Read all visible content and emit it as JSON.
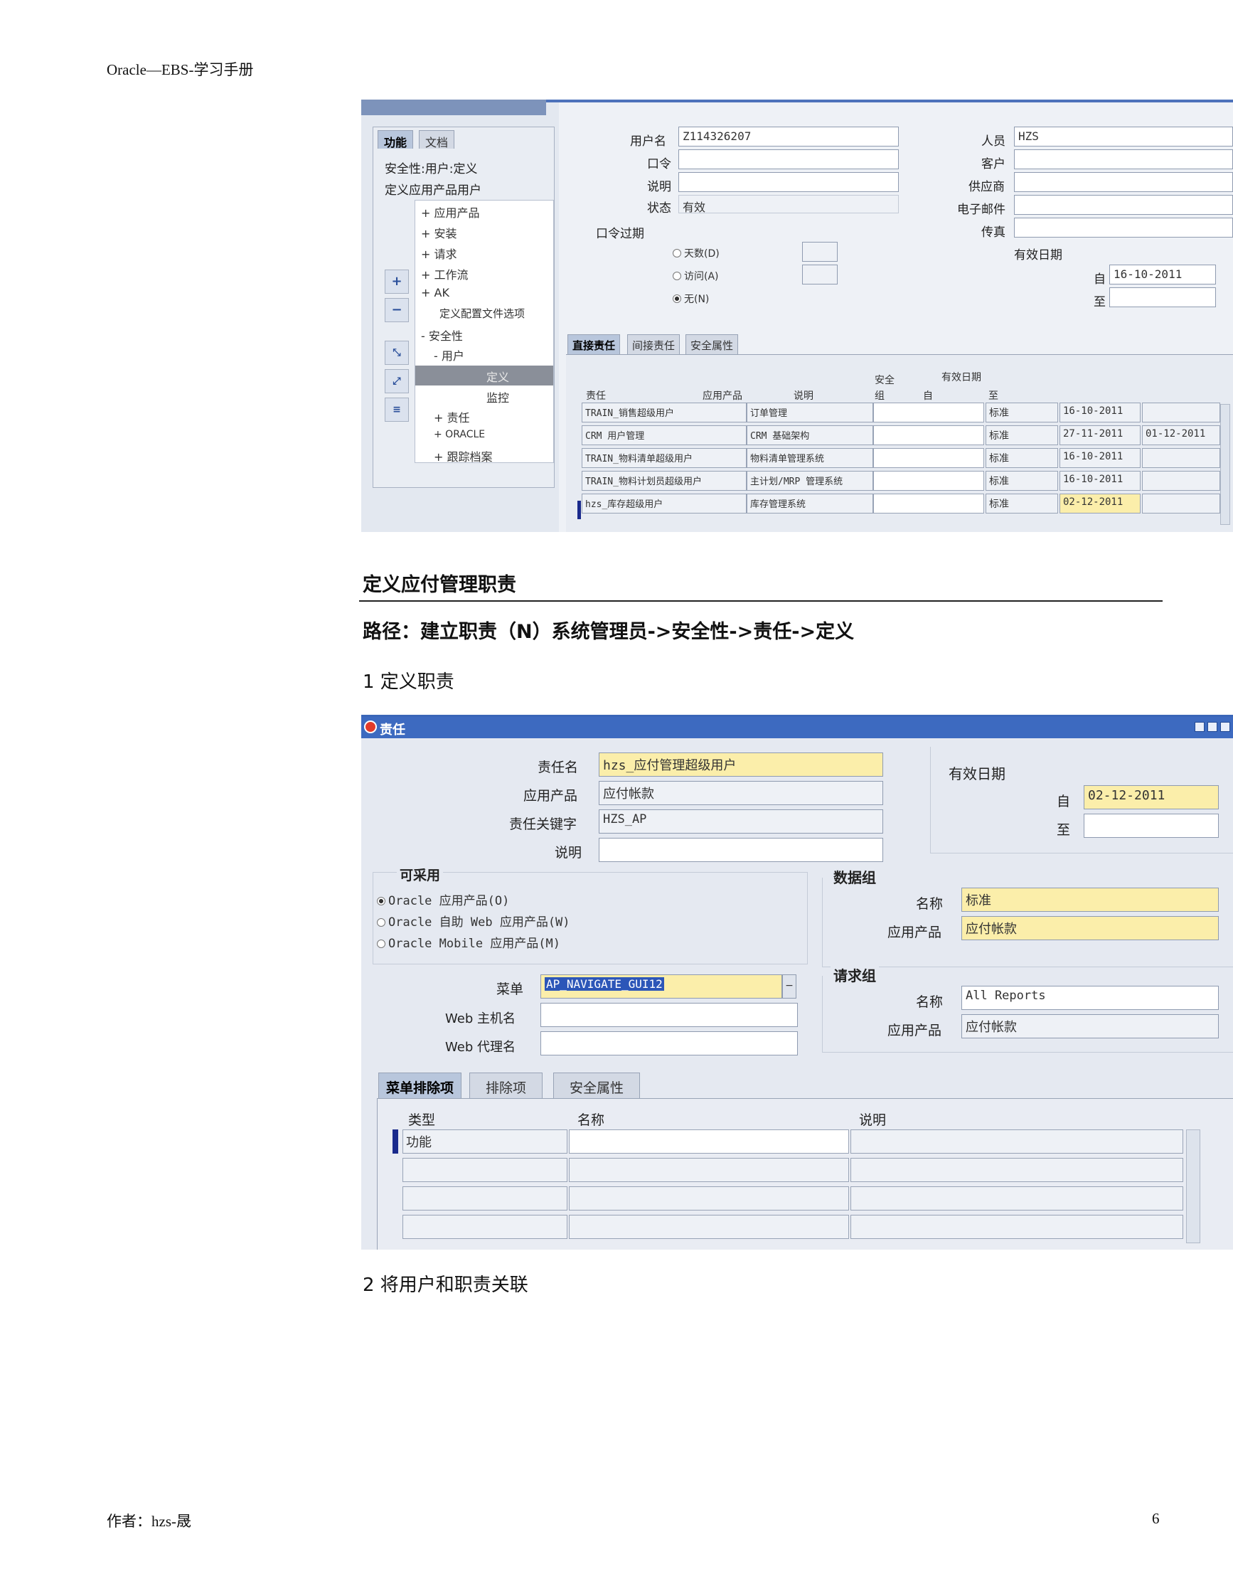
{
  "page": {
    "header": "Oracle—EBS-学习手册",
    "footer_author": "作者：hzs-晟",
    "page_number": "6",
    "section_title": "定义应付管理职责",
    "path_text": "路径：建立职责（N）系统管理员->安全性->责任->定义",
    "step1": "1 定义职责",
    "step2": "2 将用户和职责关联"
  },
  "users_form": {
    "nav": {
      "tabs": [
        "功能",
        "文档"
      ],
      "context1": "安全性:用户:定义",
      "context2": "定义应用产品用户",
      "tree": [
        "+ 应用产品",
        "+ 安装",
        "+ 请求",
        "+ 工作流",
        "+ AK",
        "定义配置文件选项",
        "- 安全性",
        "- 用户",
        "定义",
        "监控",
        "+ 责任",
        "+ ORACLE",
        "+ 跟踪档案"
      ]
    },
    "labels": {
      "username": "用户名",
      "password": "口令",
      "description": "说明",
      "status": "状态",
      "password_expiry": "口令过期",
      "person": "人员",
      "customer": "客户",
      "supplier": "供应商",
      "email": "电子邮件",
      "fax": "传真",
      "effective_dates": "有效日期",
      "from": "自",
      "to": "至"
    },
    "values": {
      "username": "Z114326207",
      "status": "有效",
      "person": "HZS",
      "from_date": "16-10-2011"
    },
    "expiry_options": [
      "天数(D)",
      "访问(A)",
      "无(N)"
    ],
    "tabs": [
      "直接责任",
      "间接责任",
      "安全属性"
    ],
    "grid": {
      "headers": [
        "责任",
        "应用产品",
        "说明",
        "安全组",
        "自",
        "至"
      ],
      "security_header_top": "安全",
      "security_header_bottom": "组",
      "dates_header": "有效日期",
      "rows": [
        [
          "TRAIN_销售超级用户",
          "订单管理",
          "",
          "标准",
          "16-10-2011",
          ""
        ],
        [
          "CRM 用户管理",
          "CRM 基础架构",
          "",
          "标准",
          "27-11-2011",
          "01-12-2011"
        ],
        [
          "TRAIN_物料清单超级用户",
          "物料清单管理系统",
          "",
          "标准",
          "16-10-2011",
          ""
        ],
        [
          "TRAIN_物料计划员超级用户",
          "主计划/MRP 管理系统",
          "",
          "标准",
          "16-10-2011",
          ""
        ],
        [
          "hzs_库存超级用户",
          "库存管理系统",
          "",
          "标准",
          "02-12-2011",
          ""
        ]
      ]
    }
  },
  "resp_form": {
    "title": "责任",
    "labels": {
      "resp_name": "责任名",
      "application": "应用产品",
      "resp_key": "责任关键字",
      "description": "说明",
      "effective_dates": "有效日期",
      "from": "自",
      "to": "至",
      "available": "可采用",
      "data_group": "数据组",
      "dg_name": "名称",
      "dg_app": "应用产品",
      "menu": "菜单",
      "web_host": "Web 主机名",
      "web_agent": "Web 代理名",
      "request_group": "请求组",
      "rg_name": "名称",
      "rg_app": "应用产品"
    },
    "values": {
      "resp_name": "hzs_应付管理超级用户",
      "application": "应付帐款",
      "resp_key": "HZS_AP",
      "from_date": "02-12-2011",
      "dg_name": "标准",
      "dg_app": "应付帐款",
      "menu": "AP_NAVIGATE_GUI12",
      "rg_name": "All Reports",
      "rg_app": "应付帐款"
    },
    "available_options": [
      "Oracle 应用产品(O)",
      "Oracle 自助 Web 应用产品(W)",
      "Oracle Mobile 应用产品(M)"
    ],
    "tabs": [
      "菜单排除项",
      "排除项",
      "安全属性"
    ],
    "grid": {
      "headers": [
        "类型",
        "名称",
        "说明"
      ],
      "first_type": "功能"
    }
  }
}
